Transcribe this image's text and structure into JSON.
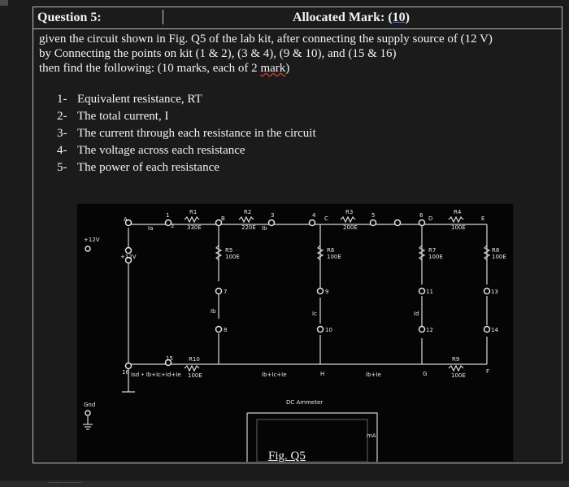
{
  "question": {
    "label": "Question 5:",
    "allocated": "Allocated Mark:",
    "mark": "(10)"
  },
  "intro": {
    "line1": "given the circuit shown in Fig. Q5 of the lab kit, after connecting the supply source of (12 V)",
    "line2": "by Connecting the points on kit (1 & 2), (3 & 4), (9 & 10), and (15 & 16)",
    "line3_pre": "then find the following: (10 marks, each of 2 ",
    "line3_mark": "mark",
    "line3_post": ")"
  },
  "tasks": [
    {
      "num": "1-",
      "text": "Equivalent resistance, RT"
    },
    {
      "num": "2-",
      "text": "The total current, I"
    },
    {
      "num": "3-",
      "text": "The current through each resistance in the circuit"
    },
    {
      "num": "4-",
      "text": "The voltage across each resistance"
    },
    {
      "num": "5-",
      "text": "The power of each resistance"
    }
  ],
  "figure": {
    "caption": "Fig. Q5",
    "plus12v": "+12V",
    "plus12v_small": "+12V",
    "gnd": "Gnd",
    "ammeter": "DC Ammeter",
    "ma": "mA",
    "nodes": {
      "a": "A",
      "b": "B",
      "c": "C",
      "d": "D",
      "e": "E",
      "f": "F",
      "g": "G",
      "h": "H"
    },
    "resistors": {
      "r1": "R1",
      "r1v": "330E",
      "r2": "R2",
      "r2v": "220E",
      "r3": "R3",
      "r3v": "200E",
      "r4": "R4",
      "r4v": "100E",
      "r5": "R5",
      "r5v": "100E",
      "r6": "R6",
      "r6v": "100E",
      "r7": "R7",
      "r7v": "100E",
      "r8": "R8",
      "r8v": "100E",
      "r9": "R9",
      "r9v": "100E",
      "r10": "R10",
      "r10v": "100E"
    },
    "pins": {
      "p1": "1",
      "p2": "2",
      "p3": "3",
      "p4": "4",
      "p5": "5",
      "p6": "6",
      "p7": "7",
      "p8": "8",
      "p9": "9",
      "p10": "10",
      "p11": "11",
      "p12": "12",
      "p13": "13",
      "p14": "14",
      "p15": "15",
      "p16": "16"
    },
    "series": {
      "s1a": "Ia",
      "s1b": "Ib",
      "s1c": "Ic",
      "s1d": "Id",
      "s1e": "Ie",
      "ib": "Ib",
      "b_left": "Ib",
      "c_mid": "Ic",
      "d_mid": "Id",
      "bottom1": "Isd • Ib+Ic+Id+Ie",
      "bottom2": "Ib+Ic+Ie",
      "bottom3": "Ib+Ie"
    }
  }
}
